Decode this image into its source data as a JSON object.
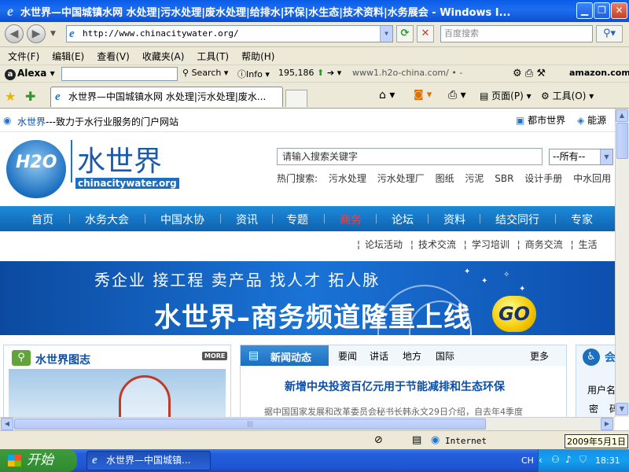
{
  "window": {
    "title": "水世界—中国城镇水网 水处理|污水处理|废水处理|给排水|环保|水生态|技术资料|水务展会 - Windows I..."
  },
  "address_bar": {
    "url": "http://www.chinacitywater.org/",
    "search_placeholder": "百度搜索"
  },
  "menu": [
    "文件(F)",
    "编辑(E)",
    "查看(V)",
    "收藏夹(A)",
    "工具(T)",
    "帮助(H)"
  ],
  "alexa_bar": {
    "brand": "Alexa",
    "search": "Search",
    "info": "Info",
    "rank": "195,186",
    "related": "www1.h2o-china.com/",
    "amazon": "amazon.com."
  },
  "tabs": {
    "active": "水世界—中国城镇水网 水处理|污水处理|废水..."
  },
  "command_bar": {
    "page": "页面(P)",
    "tools": "工具(O)"
  },
  "site": {
    "brand": "水世界",
    "tagline": "---致力于水行业服务的门户网站",
    "top_links": [
      "都市世界",
      "能源"
    ],
    "logo_text": "水世界",
    "logo_domain": "chinacitywater.org",
    "logo_h2o": "H2O",
    "search_placeholder": "请输入搜索关键字",
    "search_scope": "--所有--",
    "hot_label": "热门搜索:",
    "hot_terms": [
      "污水处理",
      "污水处理厂",
      "图纸",
      "污泥",
      "SBR",
      "设计手册",
      "中水回用"
    ],
    "nav": [
      "首页",
      "水务大会",
      "中国水协",
      "资讯",
      "专题",
      "商务",
      "论坛",
      "资料",
      "结交同行",
      "专家"
    ],
    "subnav": [
      "论坛活动",
      "技术交流",
      "学习培训",
      "商务交流",
      "生活"
    ],
    "banner_line1": "秀企业  接工程  卖产品  找人才  拓人脉",
    "banner_line2": "水世界–商务频道隆重上线",
    "banner_go": "GO",
    "gallery_title": "水世界图志",
    "more_badge": "MORE",
    "news_title": "新闻动态",
    "news_tabs": [
      "要闻",
      "讲话",
      "地方",
      "国际"
    ],
    "news_more": "更多",
    "headline": "新增中央投资百亿元用于节能减排和生态环保",
    "summary": "据中国国家发展和改革委员会秘书长韩永文29日介绍，自去年4季度",
    "login_labels": [
      "用户名",
      "密",
      "码"
    ],
    "login_heading": "会"
  },
  "status_bar": {
    "zone": "Internet",
    "date_tooltip": "2009年5月1日"
  },
  "taskbar": {
    "start": "开始",
    "window_button": "水世界—中国城镇...",
    "lang": "CH",
    "time": "18:31"
  },
  "colors": {
    "nav_blue": "#1677c9",
    "headline_blue": "#0b4ea8",
    "active_nav": "#ff3b3b"
  }
}
